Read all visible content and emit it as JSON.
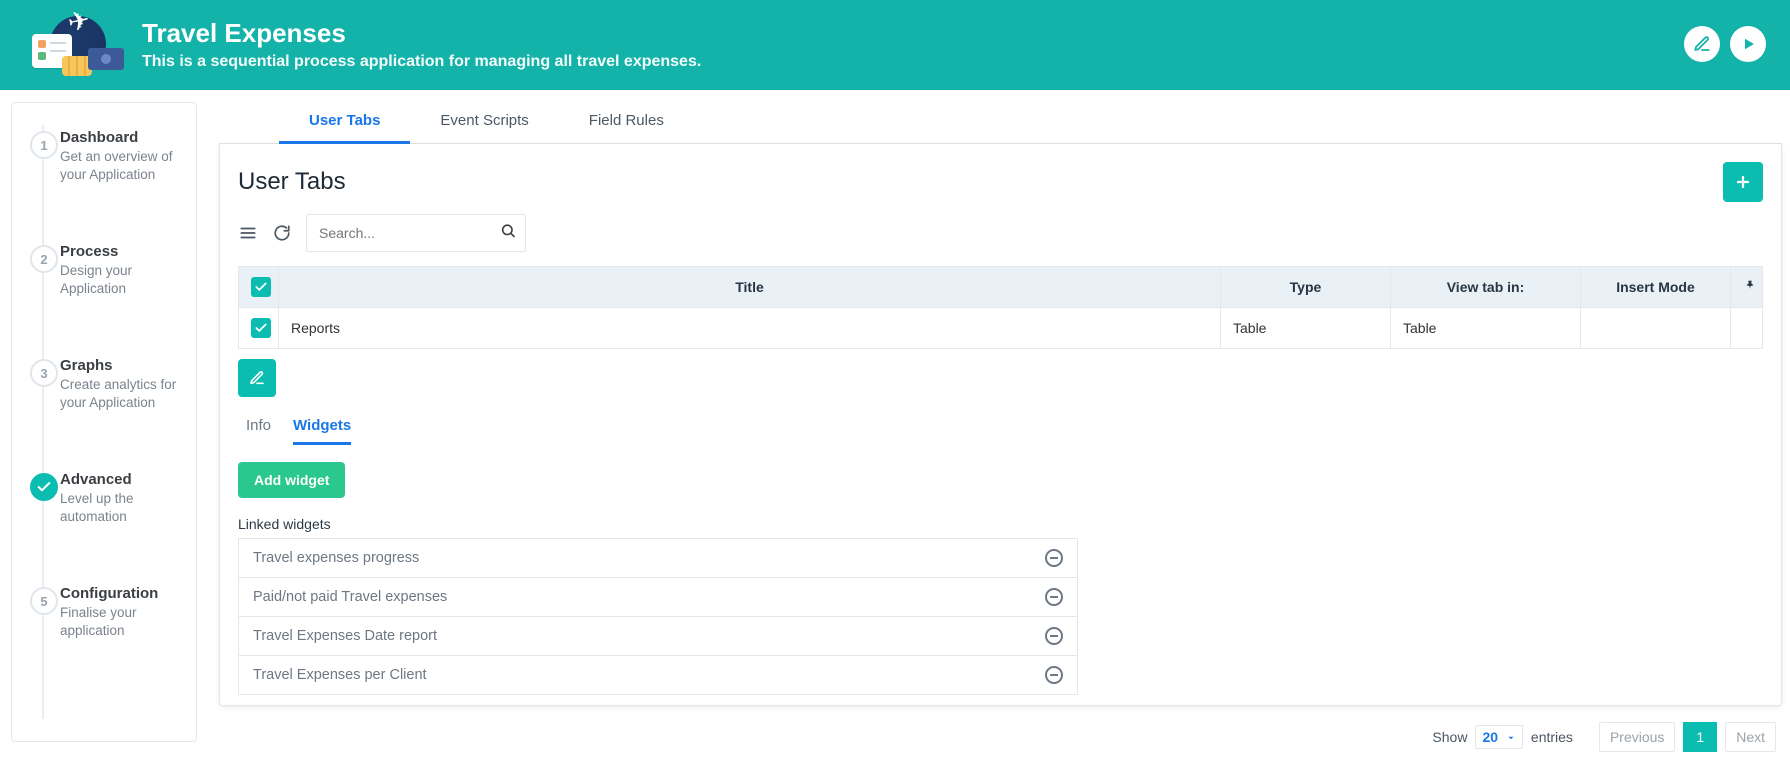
{
  "header": {
    "title": "Travel Expenses",
    "subtitle": "This is a sequential process application for managing all travel expenses."
  },
  "sidebar": {
    "steps": [
      {
        "num": "1",
        "title": "Dashboard",
        "desc": "Get an overview of your Application",
        "active": false
      },
      {
        "num": "2",
        "title": "Process",
        "desc": "Design your Application",
        "active": false
      },
      {
        "num": "3",
        "title": "Graphs",
        "desc": "Create analytics for your Application",
        "active": false
      },
      {
        "num": "✓",
        "title": "Advanced",
        "desc": "Level up the automation",
        "active": true
      },
      {
        "num": "5",
        "title": "Configuration",
        "desc": "Finalise your application",
        "active": false
      }
    ]
  },
  "tabs": [
    {
      "label": "User Tabs",
      "active": true
    },
    {
      "label": "Event Scripts",
      "active": false
    },
    {
      "label": "Field Rules",
      "active": false
    }
  ],
  "panel": {
    "title": "User Tabs",
    "search_placeholder": "Search...",
    "columns": {
      "title": "Title",
      "type": "Type",
      "view": "View tab in:",
      "ins": "Insert Mode"
    },
    "rows": [
      {
        "title": "Reports",
        "type": "Table",
        "view": "Table",
        "ins": ""
      }
    ],
    "subtabs": [
      {
        "label": "Info",
        "active": false
      },
      {
        "label": "Widgets",
        "active": true
      }
    ],
    "add_widget_label": "Add widget",
    "linked_title": "Linked widgets",
    "widgets": [
      "Travel expenses progress",
      "Paid/not paid Travel expenses",
      "Travel Expenses Date report",
      "Travel Expenses per Client"
    ]
  },
  "pager": {
    "show": "Show",
    "size": "20",
    "entries": "entries",
    "prev": "Previous",
    "current": "1",
    "next": "Next"
  }
}
